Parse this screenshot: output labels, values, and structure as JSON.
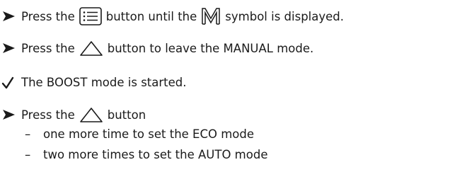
{
  "steps": [
    {
      "marker": "arrow-icon",
      "before": "Press the",
      "icon1": "menu-list-icon",
      "middle": "button until the",
      "icon2": "manual-m-icon",
      "after": "symbol is displayed."
    },
    {
      "marker": "arrow-icon",
      "before": "Press the",
      "icon1": "up-chevron-icon",
      "after": "button to leave the MANUAL mode."
    },
    {
      "marker": "check-icon",
      "text": "The BOOST mode is started."
    },
    {
      "marker": "arrow-icon",
      "before": "Press the",
      "icon1": "up-chevron-icon",
      "after": "button",
      "subitems": [
        {
          "dash": "–",
          "text": "one more time to set the ECO mode"
        },
        {
          "dash": "–",
          "text": "two more times to set the AUTO mode"
        }
      ]
    }
  ]
}
